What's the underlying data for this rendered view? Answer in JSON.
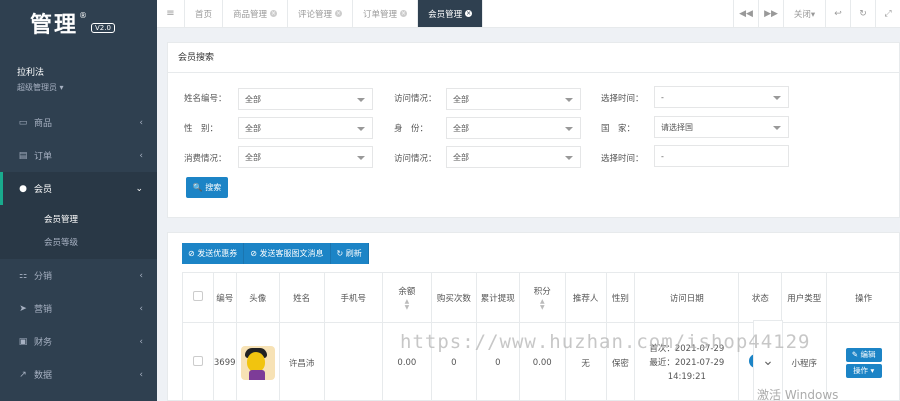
{
  "sidebar": {
    "logo": "管理",
    "logo_mark": "®",
    "version": "V2.0",
    "user_name": "拉利法",
    "user_role": "超级管理员 ▾",
    "items": [
      {
        "label": "商品",
        "icon": "desktop-icon",
        "glyph": "▭",
        "arrow": "‹"
      },
      {
        "label": "订单",
        "icon": "list-icon",
        "glyph": "▤",
        "arrow": "‹"
      },
      {
        "label": "会员",
        "icon": "user-icon",
        "glyph": "●",
        "arrow": "⌄"
      },
      {
        "label": "分销",
        "icon": "sitemap-icon",
        "glyph": "⚏",
        "arrow": "‹"
      },
      {
        "label": "营销",
        "icon": "send-icon",
        "glyph": "➤",
        "arrow": "‹"
      },
      {
        "label": "财务",
        "icon": "money-icon",
        "glyph": "▣",
        "arrow": "‹"
      },
      {
        "label": "数据",
        "icon": "chart-icon",
        "glyph": "↗",
        "arrow": "‹"
      }
    ],
    "sub_items": [
      "会员管理",
      "会员等级"
    ]
  },
  "topbar": {
    "menu_icon": "≡",
    "tabs": [
      {
        "label": "首页"
      },
      {
        "label": "商品管理"
      },
      {
        "label": "评论管理"
      },
      {
        "label": "订单管理"
      },
      {
        "label": "会员管理"
      }
    ],
    "close_label": "关闭▾",
    "prev_icon": "◀◀",
    "next_icon": "▶▶",
    "back_icon": "↩",
    "refresh_icon": "↻",
    "fullscreen_icon": "⤢"
  },
  "search": {
    "title": "会员搜索",
    "labels": {
      "id": "姓名编号：",
      "visit1": "访问情况：",
      "time1": "选择时间：",
      "gender": "性　别：",
      "identity": "身　份：",
      "country": "国　家：",
      "consume": "消费情况：",
      "visit2": "访问情况：",
      "time2": "选择时间："
    },
    "values": {
      "id": "全部",
      "visit1": "全部",
      "time1": "-",
      "gender": "全部",
      "identity": "全部",
      "country": "请选择国",
      "consume": "全部",
      "visit2": "全部",
      "time2": "-"
    },
    "button": "🔍 搜索"
  },
  "table": {
    "actions": [
      "⊘ 发送优惠券",
      "⊘ 发送客服图文消息",
      "↻ 刷新"
    ],
    "headers": [
      "编号",
      "头像",
      "姓名",
      "手机号",
      "余额",
      "购买次数",
      "累计提现",
      "积分",
      "推荐人",
      "性别",
      "访问日期",
      "状态",
      "用户类型",
      "操作"
    ],
    "row": {
      "id": "3699",
      "name": "许昌沛",
      "phone": "",
      "balance": "0.00",
      "purchases": "0",
      "withdraw": "0",
      "points": "0.00",
      "referrer": "无",
      "gender": "保密",
      "visit_first": "首次：2021-07-29",
      "visit_last": "最近：2021-07-29 14:19:21",
      "user_type": "小程序",
      "edit": "✎ 编辑",
      "more": "操作 ▾"
    }
  },
  "overlay": {
    "watermark": "https://www.huzhan.com/ishop44129",
    "windows": "激活 Windows"
  }
}
